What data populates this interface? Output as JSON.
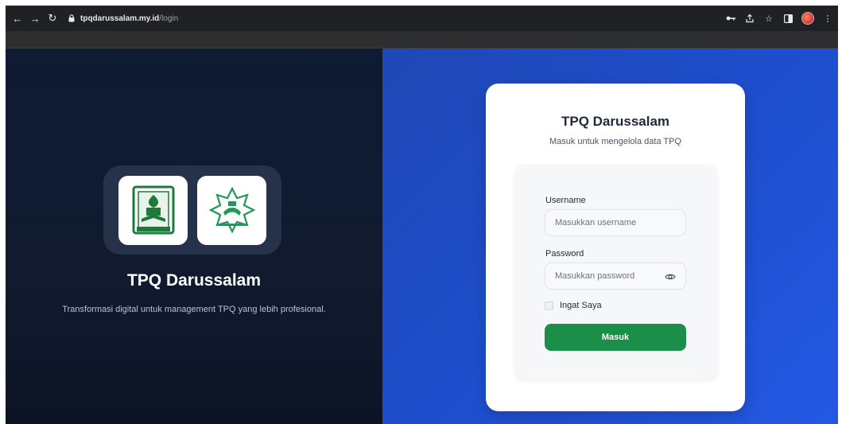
{
  "browser": {
    "url_host": "tpqdarussalam.my.id",
    "url_path": "/login"
  },
  "left_panel": {
    "logo1_icon": "tpq-logo-green",
    "logo2_icon": "darussalam-logo-star",
    "title": "TPQ Darussalam",
    "tagline": "Transformasi digital untuk management TPQ yang lebih profesional."
  },
  "login": {
    "title": "TPQ Darussalam",
    "subtitle": "Masuk untuk mengelola data TPQ",
    "username_label": "Username",
    "username_placeholder": "Masukkan username",
    "password_label": "Password",
    "password_placeholder": "Masukkan password",
    "remember_label": "Ingat Saya",
    "submit_label": "Masuk"
  },
  "colors": {
    "left_bg": "#0f1a33",
    "right_bg": "#1e4fcf",
    "button": "#1b8f4a"
  }
}
